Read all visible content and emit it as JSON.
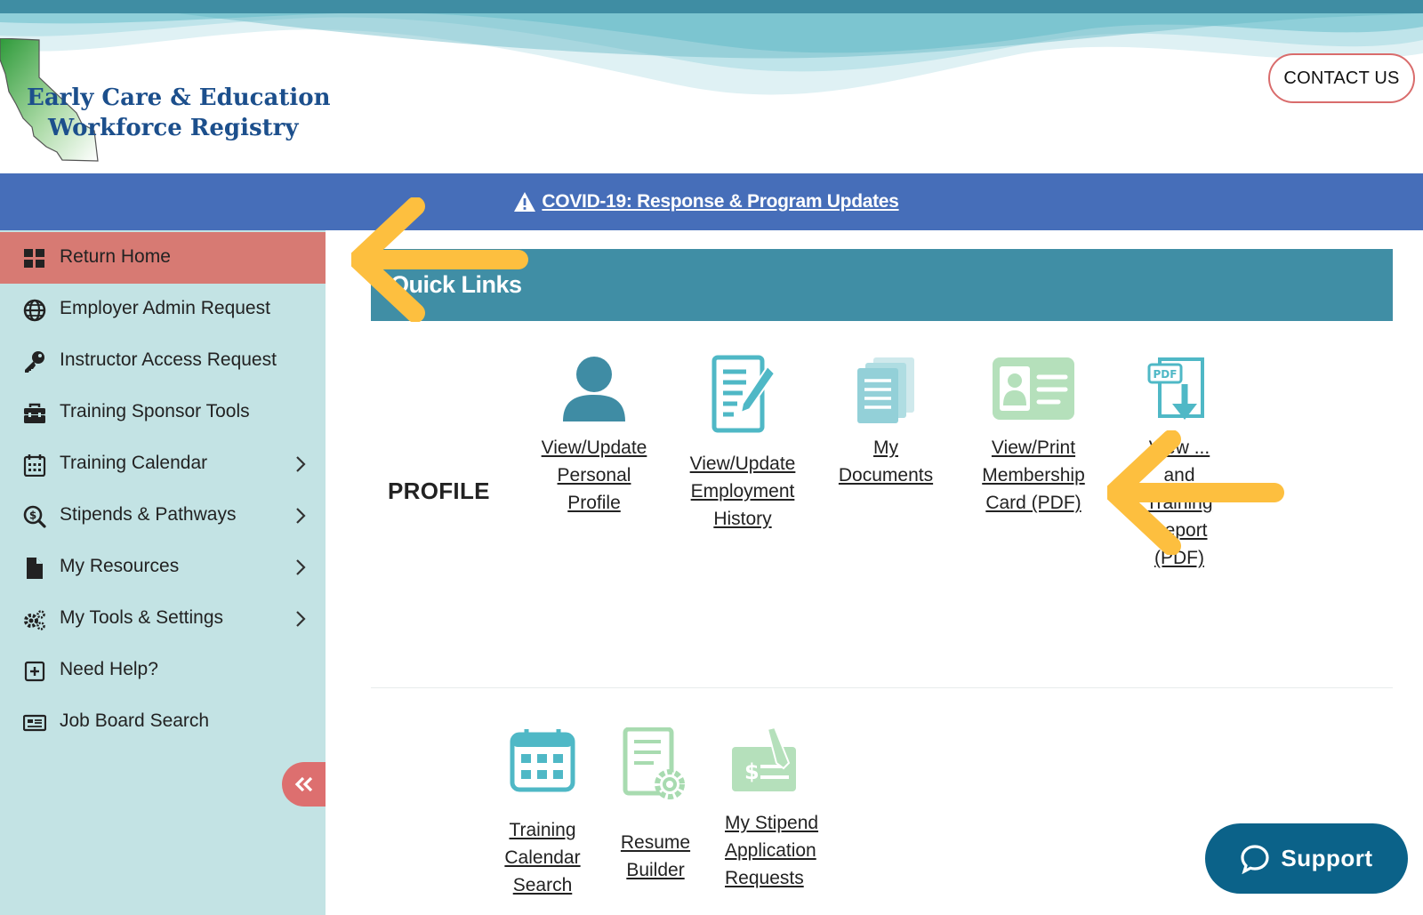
{
  "header": {
    "logo_line1": "Early Care & Education",
    "logo_line2": "Workforce Registry",
    "contact_label": "CONTACT US"
  },
  "banner": {
    "label": "COVID-19: Response & Program Updates"
  },
  "sidebar": {
    "items": [
      {
        "label": "Return Home",
        "icon": "grid-icon",
        "active": true,
        "has_submenu": false
      },
      {
        "label": "Employer Admin Request",
        "icon": "globe-icon",
        "active": false,
        "has_submenu": false
      },
      {
        "label": "Instructor Access Request",
        "icon": "key-icon",
        "active": false,
        "has_submenu": false
      },
      {
        "label": "Training Sponsor Tools",
        "icon": "toolbox-icon",
        "active": false,
        "has_submenu": false
      },
      {
        "label": "Training Calendar",
        "icon": "calendar-icon",
        "active": false,
        "has_submenu": true
      },
      {
        "label": "Stipends & Pathways",
        "icon": "search-dollar-icon",
        "active": false,
        "has_submenu": true
      },
      {
        "label": "My Resources",
        "icon": "file-icon",
        "active": false,
        "has_submenu": true
      },
      {
        "label": "My Tools & Settings",
        "icon": "gears-icon",
        "active": false,
        "has_submenu": true
      },
      {
        "label": "Need Help?",
        "icon": "plus-square-icon",
        "active": false,
        "has_submenu": false
      },
      {
        "label": "Job Board Search",
        "icon": "newspaper-icon",
        "active": false,
        "has_submenu": false
      }
    ],
    "collapse_icon": "double-chevron-left-icon"
  },
  "main": {
    "quick_links_title": "Quick Links",
    "profile_label": "PROFILE",
    "profile_tiles": [
      {
        "label": "View/Update Personal Profile",
        "icon": "user-icon"
      },
      {
        "label": "View/Update Employment History",
        "icon": "edit-document-icon"
      },
      {
        "label": "My Documents",
        "icon": "documents-icon"
      },
      {
        "label": "View/Print Membership Card (PDF)",
        "icon": "id-card-icon"
      },
      {
        "label": "View ... and Training Report (PDF)",
        "icon": "pdf-download-icon"
      }
    ],
    "tool_tiles": [
      {
        "label": "Training Calendar Search",
        "icon": "calendar-grid-icon"
      },
      {
        "label": "Resume Builder",
        "icon": "document-gear-icon"
      },
      {
        "label": "My Stipend Application Requests",
        "icon": "check-signature-icon"
      }
    ],
    "support_label": "Support"
  },
  "colors": {
    "accent_teal": "#408ea5",
    "banner_blue": "#466eb9",
    "active_red": "#d77a73",
    "sidebar_bg": "#c3e3e4",
    "support_blue": "#0b6289",
    "arrow_yellow": "#fdbf3f"
  }
}
